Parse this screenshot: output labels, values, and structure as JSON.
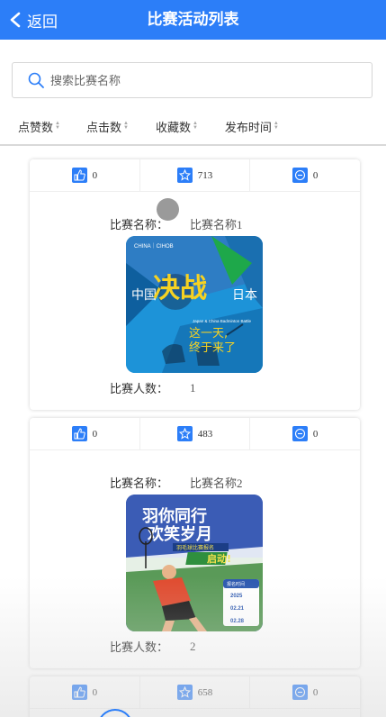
{
  "header": {
    "back_label": "返回",
    "title": "比赛活动列表"
  },
  "search": {
    "placeholder": "搜索比赛名称"
  },
  "sort": [
    "点赞数",
    "点击数",
    "收藏数",
    "发布时间"
  ],
  "labels": {
    "name": "比赛名称：",
    "count": "比赛人数："
  },
  "cards": [
    {
      "likes": "0",
      "favorites": "713",
      "comments": "0",
      "name": "比赛名称1",
      "count": "1",
      "poster": {
        "brand": "CHINA｜CIHOB",
        "big": "决战",
        "left": "中国",
        "right": "日本",
        "slogan1": "这一天,",
        "slogan2": "终于来了",
        "small": "Japan & China Badminton Battle"
      }
    },
    {
      "likes": "0",
      "favorites": "483",
      "comments": "0",
      "name": "比赛名称2",
      "count": "2",
      "poster": {
        "line1": "羽你同行",
        "line2": "欢笑岁月",
        "banner": "羽毛球比赛报名",
        "start": "启动!",
        "date_head": "报名时间",
        "d1": "2025",
        "d2": "02.21",
        "d3": "02.28"
      }
    },
    {
      "likes": "0",
      "favorites": "658",
      "comments": "0"
    }
  ],
  "colors": {
    "primary": "#2c7ef8",
    "border": "#d9d9d9"
  }
}
